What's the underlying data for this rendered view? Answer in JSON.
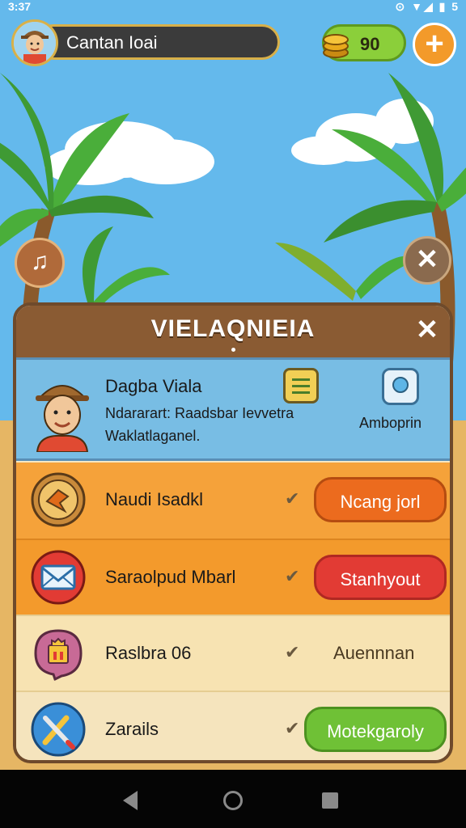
{
  "status_bar": {
    "time": "3:37",
    "icons": "⊙ ▼◢ ▮ 5"
  },
  "hud": {
    "player_name": "Cantan Ioai",
    "coins": "90",
    "add_label": "+"
  },
  "side_buttons": {
    "music": "♫",
    "close": "✕"
  },
  "panel": {
    "title": "VIELAQNIEIA",
    "close": "✕",
    "profile": {
      "name": "Dagba Viala",
      "line1": "Ndararart: Raadsbar Ievvetra",
      "line2": "Waklatlaganel.",
      "action_label": "Amboprin"
    },
    "rows": [
      {
        "label": "Naudi Isadkl",
        "check": "✔",
        "button": "Ncang jorl"
      },
      {
        "label": "Saraolpud Mbarl",
        "check": "✔",
        "button": "Stanhyout"
      },
      {
        "label": "Raslbra 06",
        "check": "✔",
        "action": "Auennnan"
      },
      {
        "label": "Zarails",
        "check": "✔",
        "button": "Motekgaroly"
      }
    ]
  },
  "colors": {
    "sky": "#64b9ec",
    "panel_header": "#8a5b33",
    "orange_button": "#ec6b1e",
    "red_button": "#e23b34",
    "green_button": "#6fc136"
  }
}
